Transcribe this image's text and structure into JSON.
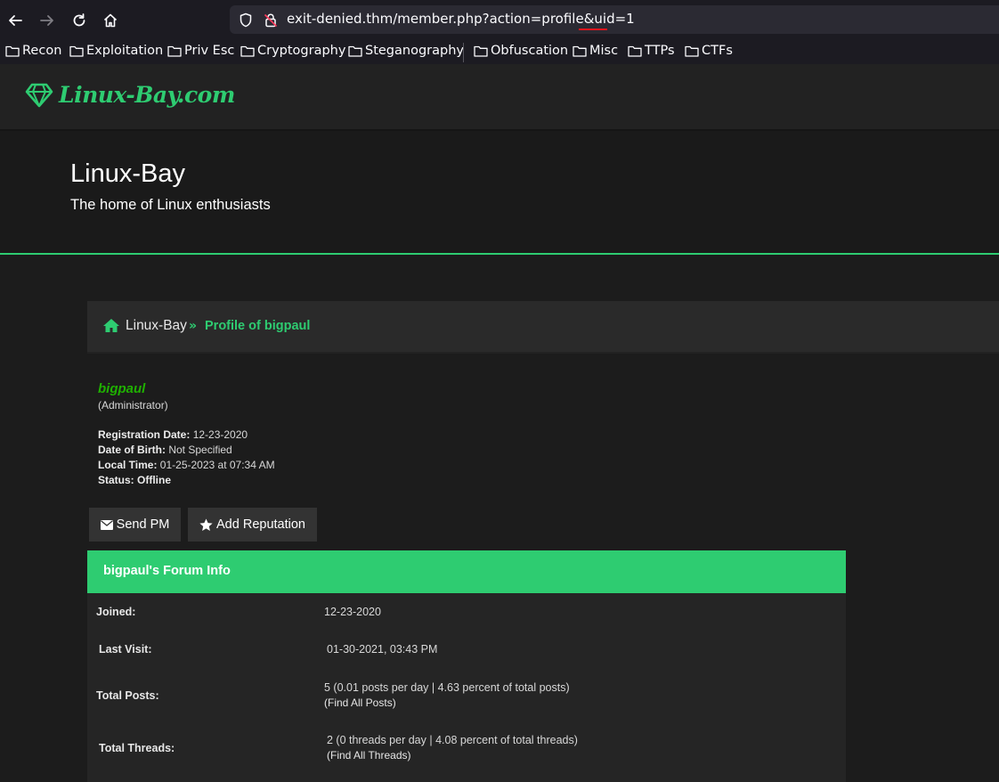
{
  "browser": {
    "url": "exit-denied.thm/member.php?action=profile&uid=1",
    "bookmarks": [
      "Recon",
      "Exploitation",
      "Priv Esc",
      "Cryptography",
      "Steganography",
      "Obfuscation",
      "Misc",
      "TTPs",
      "CTFs"
    ]
  },
  "site": {
    "logo_text": "Linux-Bay.com",
    "banner_title": "Linux-Bay",
    "banner_subtitle": "The home of Linux enthusiasts"
  },
  "breadcrumb": {
    "root": "Linux-Bay",
    "separator": "»",
    "current": "Profile of bigpaul"
  },
  "profile": {
    "username": "bigpaul",
    "usertitle": "(Administrator)",
    "details": [
      {
        "label": "Registration Date:",
        "value": " 12-23-2020"
      },
      {
        "label": "Date of Birth:",
        "value": " Not Specified"
      },
      {
        "label": "Local Time:",
        "value": " 01-25-2023 at 07:34 AM"
      },
      {
        "label": "Status:",
        "value": " Offline"
      }
    ],
    "buttons": {
      "send_pm": "Send PM",
      "add_reputation": "Add Reputation"
    }
  },
  "forum_info": {
    "title": "bigpaul's Forum Info",
    "rows": [
      {
        "label": "Joined:",
        "value": "12-23-2020",
        "link": ""
      },
      {
        "label": "Last Visit:",
        "value": "01-30-2021, 03:43 PM",
        "link": ""
      },
      {
        "label": "Total Posts:",
        "value": "5 (0.01 posts per day | 4.63 percent of total posts)",
        "link": "(Find All Posts)"
      },
      {
        "label": "Total Threads:",
        "value": "2 (0 threads per day | 4.08 percent of total threads)",
        "link": "(Find All Threads)"
      }
    ]
  },
  "colors": {
    "accent": "#2ecc71",
    "username": "#1fb000"
  }
}
